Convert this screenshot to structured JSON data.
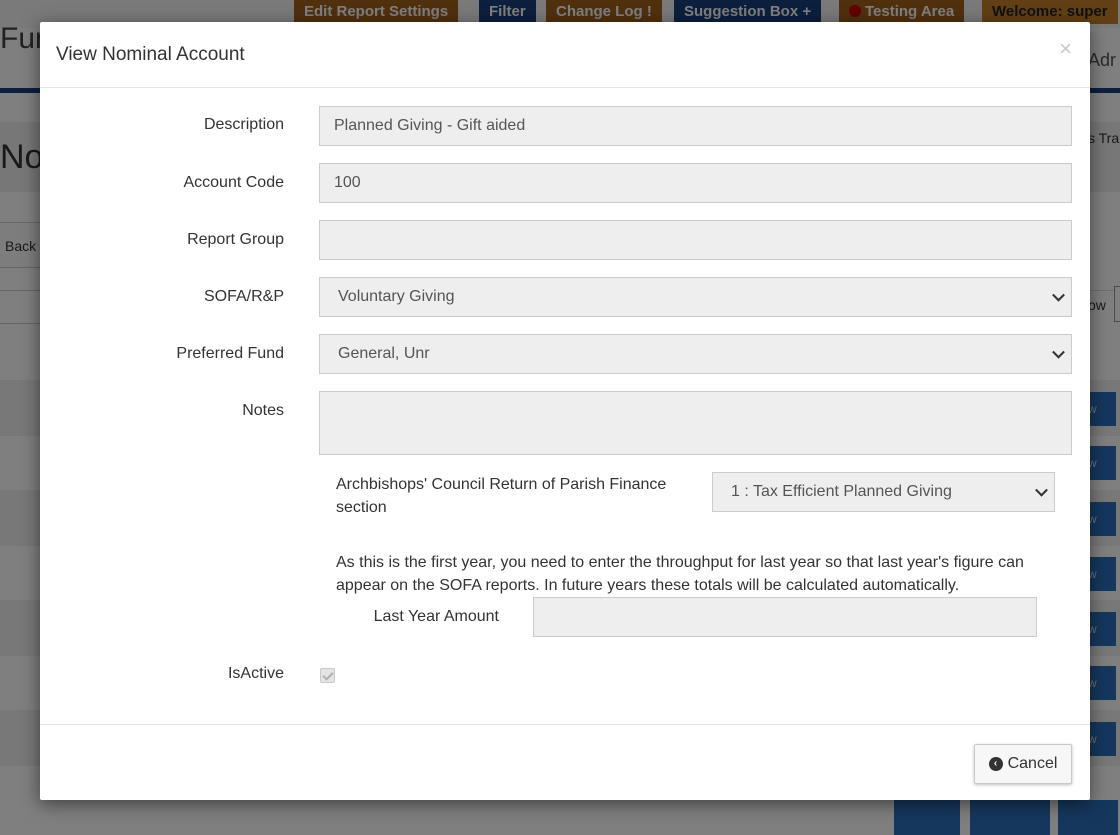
{
  "background": {
    "nav_tabs": [
      "Edit Report Settings",
      "Filter",
      "Change Log",
      "Suggestion Box",
      "Testing Area",
      "Welcome:  super"
    ],
    "logo_fragment": "Fun",
    "admin_fragment": "Adr",
    "title_fragment": "Nor",
    "tra_fragment": "s Tra",
    "back_fragment": "Back",
    "show_fragment": "ow"
  },
  "modal": {
    "title": "View Nominal Account",
    "close_glyph": "×",
    "fields": {
      "description": {
        "label": "Description",
        "value": "Planned Giving - Gift aided"
      },
      "account_code": {
        "label": "Account Code",
        "value": "100"
      },
      "report_group": {
        "label": "Report Group",
        "value": ""
      },
      "sofa_rp": {
        "label": "SOFA/R&P",
        "value": "Voluntary Giving"
      },
      "preferred_fund": {
        "label": "Preferred Fund",
        "value": "General, Unr"
      },
      "notes": {
        "label": "Notes",
        "value": ""
      }
    },
    "archbishops": {
      "label": "Archbishops' Council Return of Parish Finance section",
      "value": "1 : Tax Efficient Planned Giving"
    },
    "first_year_text": "As this is the first year, you need to enter the throughput for last year so that last year's figure can appear on the SOFA reports. In future years these totals will be calculated automatically.",
    "last_year_amount": {
      "label": "Last Year Amount",
      "value": ""
    },
    "is_active": {
      "label": "IsActive",
      "checked": true
    },
    "cancel_label": "Cancel"
  },
  "colors": {
    "nav_brown": "#a3611d",
    "nav_navy": "#193f7d",
    "action_blue": "#2a6ebb",
    "field_bg": "#eeeeee"
  }
}
